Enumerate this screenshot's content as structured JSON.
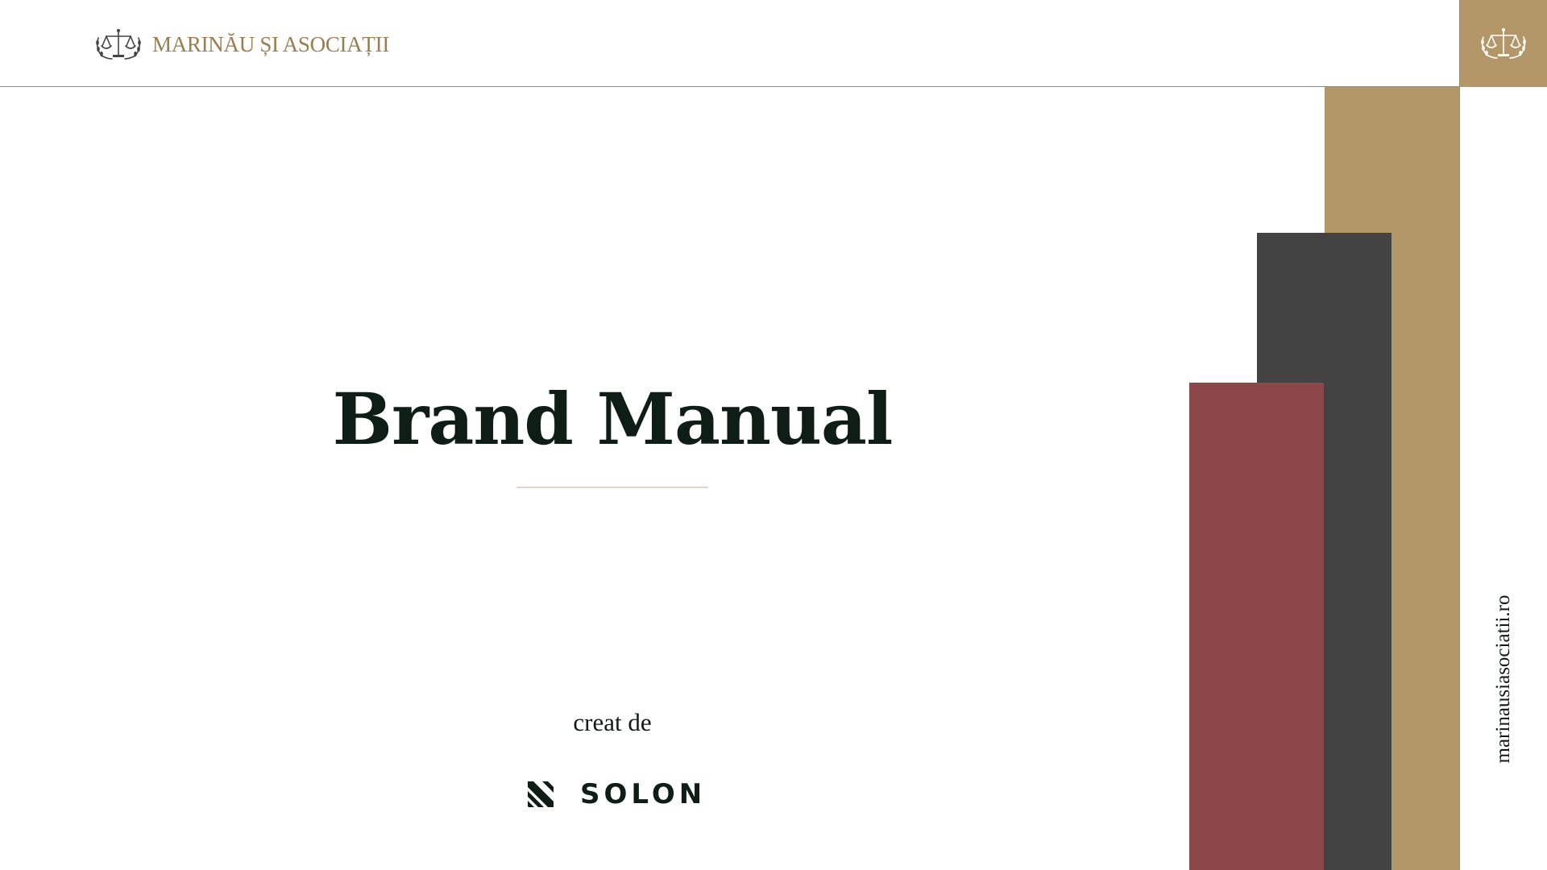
{
  "header": {
    "firm_name": "MARINĂU ȘI ASOCIAȚII",
    "logo_icon": "scales-of-justice-laurel-icon"
  },
  "side": {
    "website": "marinausiasociatii.ro",
    "badge_icon": "scales-of-justice-laurel-icon"
  },
  "main": {
    "title": "Brand Manual",
    "credit_label": "creat de",
    "creator_name": "SOLON",
    "creator_icon": "solon-logo-mark-icon"
  },
  "colors": {
    "gold": "#b39768",
    "dark_gray": "#434343",
    "burgundy": "#8d4748",
    "title_text": "#0e1d15",
    "firm_name_text": "#9a7d51"
  }
}
